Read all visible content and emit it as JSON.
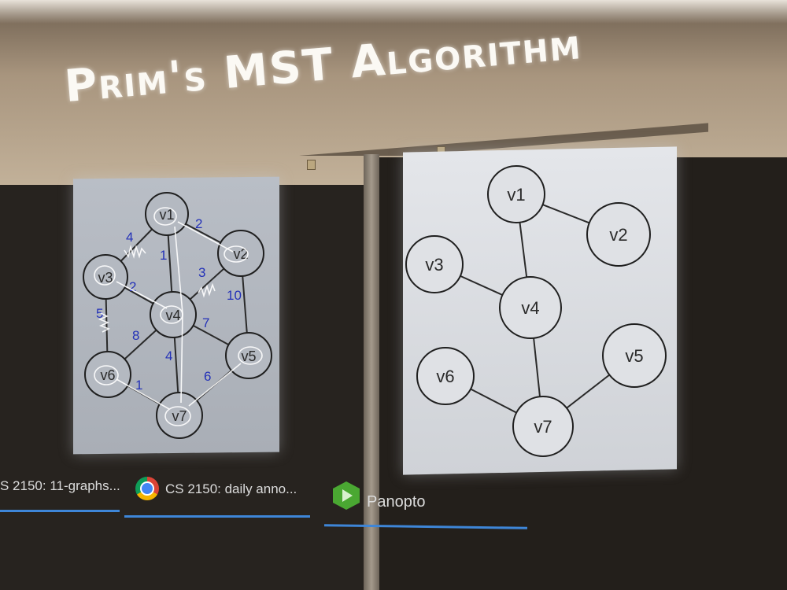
{
  "slide_title": "Prim's MST Algorithm",
  "left_graph": {
    "nodes": [
      {
        "id": "v1",
        "label": "v1"
      },
      {
        "id": "v2",
        "label": "v2"
      },
      {
        "id": "v3",
        "label": "v3"
      },
      {
        "id": "v4",
        "label": "v4"
      },
      {
        "id": "v5",
        "label": "v5"
      },
      {
        "id": "v6",
        "label": "v6"
      },
      {
        "id": "v7",
        "label": "v7"
      }
    ],
    "weights": {
      "v1_v2": "2",
      "v1_v3": "4",
      "v1_v4": "1",
      "v3_v4": "2",
      "v2_v4": "3",
      "v2_v5": "10",
      "v3_v6": "5",
      "v4_v6": "8",
      "v4_v5": "7",
      "v4_v7": "4",
      "v6_v7": "1",
      "v5_v7": "6"
    }
  },
  "right_graph": {
    "nodes": [
      {
        "id": "v1",
        "label": "v1"
      },
      {
        "id": "v2",
        "label": "v2"
      },
      {
        "id": "v3",
        "label": "v3"
      },
      {
        "id": "v4",
        "label": "v4"
      },
      {
        "id": "v5",
        "label": "v5"
      },
      {
        "id": "v6",
        "label": "v6"
      },
      {
        "id": "v7",
        "label": "v7"
      }
    ]
  },
  "taskbar": {
    "tab1": "S 2150: 11-graphs...",
    "tab2": "CS 2150: daily anno...",
    "tab3": "Panopto"
  },
  "colors": {
    "weight_ink": "#2432b8",
    "taskbar_accent": "#3e86d8"
  }
}
